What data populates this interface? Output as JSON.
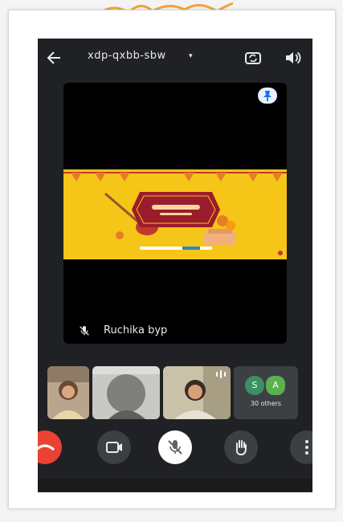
{
  "meeting": {
    "code": "xdp-qxbb-sbw",
    "caret": "▾"
  },
  "icons": {
    "back": "arrow-left-icon",
    "switch_camera": "camera-switch-icon",
    "speaker": "speaker-icon",
    "pin": "pin-icon",
    "mic_off": "mic-off-icon",
    "end_call": "phone-hang-up-icon",
    "camera": "camera-icon",
    "raise_hand": "hand-icon",
    "more": "more-vertical-icon"
  },
  "presenter": {
    "name": "Ruchika byp"
  },
  "participants": {
    "others_avatars": [
      "S",
      "A"
    ],
    "others_label": "30 others"
  },
  "colors": {
    "end_call": "#ea4335",
    "banner": "#f5c518",
    "banner_card": "#9b1c2c",
    "avatar_s": "#3d8f62",
    "avatar_a": "#5bb04f"
  }
}
